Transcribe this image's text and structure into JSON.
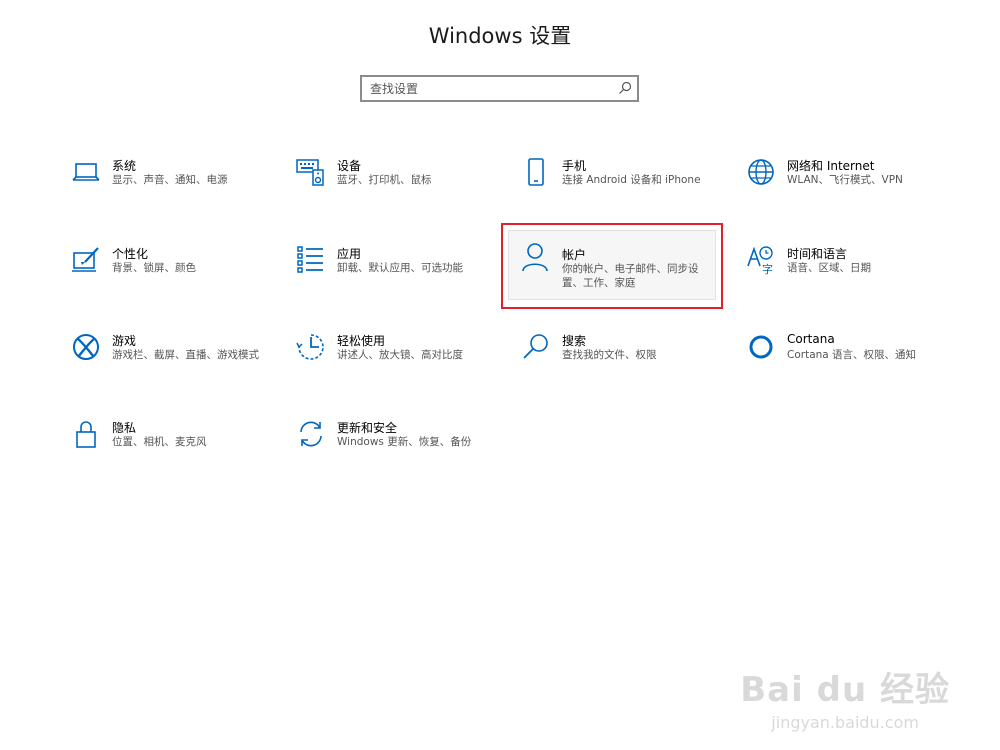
{
  "title": "Windows 设置",
  "search": {
    "placeholder": "查找设置"
  },
  "tiles": [
    {
      "name": "系统",
      "desc": "显示、声音、通知、电源",
      "icon": "laptop-icon"
    },
    {
      "name": "设备",
      "desc": "蓝牙、打印机、鼠标",
      "icon": "keyboard-speaker-icon"
    },
    {
      "name": "手机",
      "desc": "连接 Android 设备和 iPhone",
      "icon": "phone-icon"
    },
    {
      "name": "网络和 Internet",
      "desc": "WLAN、飞行模式、VPN",
      "icon": "globe-icon"
    },
    {
      "name": "个性化",
      "desc": "背景、锁屏、颜色",
      "icon": "paint-brush-icon"
    },
    {
      "name": "应用",
      "desc": "卸载、默认应用、可选功能",
      "icon": "apps-list-icon"
    },
    {
      "name": "帐户",
      "desc": "你的帐户、电子邮件、同步设置、工作、家庭",
      "icon": "person-icon"
    },
    {
      "name": "时间和语言",
      "desc": "语音、区域、日期",
      "icon": "time-language-icon"
    },
    {
      "name": "游戏",
      "desc": "游戏栏、截屏、直播、游戏模式",
      "icon": "xbox-icon"
    },
    {
      "name": "轻松使用",
      "desc": "讲述人、放大镜、高对比度",
      "icon": "ease-of-access-icon"
    },
    {
      "name": "搜索",
      "desc": "查找我的文件、权限",
      "icon": "magnifier-icon"
    },
    {
      "name": "Cortana",
      "desc": "Cortana 语言、权限、通知",
      "icon": "cortana-ring-icon"
    },
    {
      "name": "隐私",
      "desc": "位置、相机、麦克风",
      "icon": "lock-icon"
    },
    {
      "name": "更新和安全",
      "desc": "Windows 更新、恢复、备份",
      "icon": "sync-arrows-icon"
    }
  ],
  "colors": {
    "accent": "#0067c0",
    "highlight_border": "#e0202a"
  },
  "watermark": {
    "main": "Bai du 经验",
    "url": "jingyan.baidu.com"
  }
}
